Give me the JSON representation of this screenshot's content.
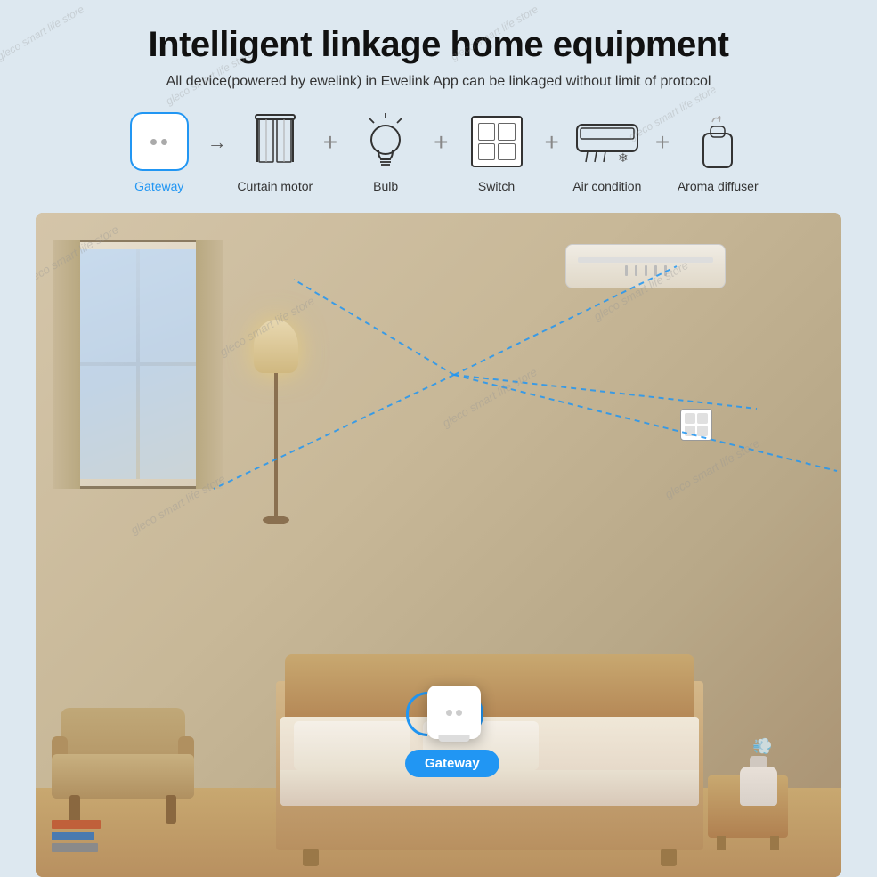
{
  "page": {
    "title": "Intelligent linkage home equipment",
    "subtitle": "All device(powered by ewelink) in Ewelink App can be linkaged without limit of protocol",
    "background_color": "#dde8f0"
  },
  "devices": [
    {
      "id": "gateway",
      "label": "Gateway",
      "label_color": "blue"
    },
    {
      "id": "curtain_motor",
      "label": "Curtain motor",
      "label_color": "dark"
    },
    {
      "id": "bulb",
      "label": "Bulb",
      "label_color": "dark"
    },
    {
      "id": "switch",
      "label": "Switch",
      "label_color": "dark"
    },
    {
      "id": "air_condition",
      "label": "Air condition",
      "label_color": "dark"
    },
    {
      "id": "aroma_diffuser",
      "label": "Aroma diffuser",
      "label_color": "dark"
    }
  ],
  "bedroom": {
    "gateway_label": "Gateway",
    "gateway_badge_color": "#2196f3"
  },
  "watermarks": [
    "gleco smart life store",
    "gleco smart life store",
    "gleco smart life store",
    "gleco smart life store",
    "gleco smart life store",
    "gleco smart life store"
  ]
}
